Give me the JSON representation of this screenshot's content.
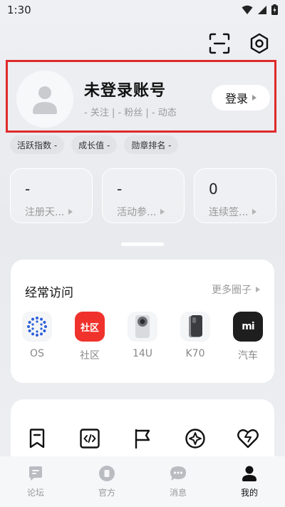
{
  "status_bar": {
    "time": "1:30"
  },
  "profile": {
    "name": "未登录账号",
    "stats": "- 关注 | - 粉丝 | - 动态",
    "login_label": "登录"
  },
  "chips": [
    "活跃指数 -",
    "成长值 -",
    "勋章排名 -"
  ],
  "stat_cards": [
    {
      "value": "-",
      "label": "注册天..."
    },
    {
      "value": "-",
      "label": "活动参..."
    },
    {
      "value": "0",
      "label": "连续签..."
    }
  ],
  "frequent": {
    "title": "经常访问",
    "more_label": "更多圈子",
    "items": [
      {
        "label": "OS",
        "icon": "os-logo-icon"
      },
      {
        "label": "社区",
        "icon_text": "社区",
        "icon": "community-logo-icon"
      },
      {
        "label": "14U",
        "icon": "phone-14u-icon"
      },
      {
        "label": "K70",
        "icon": "phone-k70-icon"
      },
      {
        "label": "汽车",
        "icon_text": "mi",
        "icon": "car-logo-icon"
      }
    ]
  },
  "tools": [
    "bookmark-icon",
    "code-icon",
    "flag-icon",
    "compass-icon",
    "heart-icon"
  ],
  "bottom_nav": [
    {
      "label": "论坛",
      "icon": "forum-icon"
    },
    {
      "label": "官方",
      "icon": "official-icon"
    },
    {
      "label": "消息",
      "icon": "message-icon"
    },
    {
      "label": "我的",
      "icon": "profile-icon",
      "active": true
    }
  ],
  "colors": {
    "highlight_border": "#e02a2a",
    "community_red": "#f0322c",
    "car_black": "#1e1e1e"
  }
}
